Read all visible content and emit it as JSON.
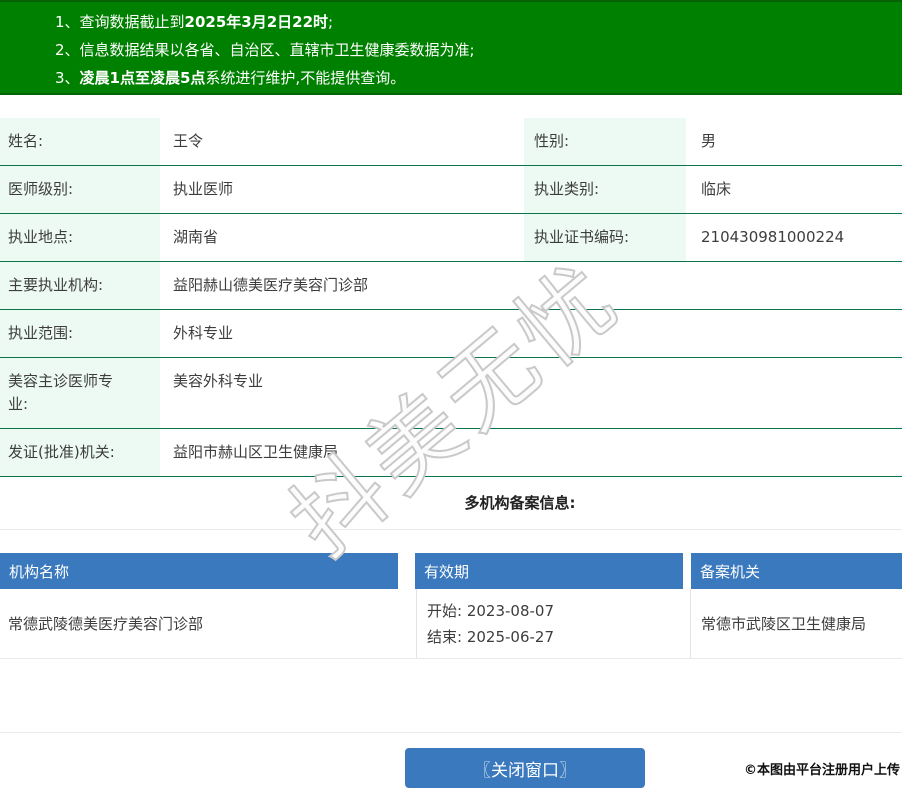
{
  "banner": {
    "notices": [
      [
        {
          "t": "1、查询数据截止到",
          "b": false
        },
        {
          "t": "2025年3月2日22时",
          "b": true
        },
        {
          "t": ";",
          "b": false
        }
      ],
      [
        {
          "t": "2、信息数据结果以各省、自治区、直辖市卫生健康委数据为准;",
          "b": false
        }
      ],
      [
        {
          "t": "3、",
          "b": false
        },
        {
          "t": "凌晨1点至凌晨5点",
          "b": true
        },
        {
          "t": "系统进行维护,不能提供查询。",
          "b": false
        }
      ]
    ]
  },
  "info_table": {
    "rows": [
      {
        "pair": true,
        "label1": "姓名:",
        "value1": "王令",
        "label2": "性别:",
        "value2": "男"
      },
      {
        "pair": true,
        "label1": "医师级别:",
        "value1": "执业医师",
        "label2": "执业类别:",
        "value2": "临床"
      },
      {
        "pair": true,
        "label1": "执业地点:",
        "value1": "湖南省",
        "label2": "执业证书编码:",
        "value2": "210430981000224"
      },
      {
        "pair": false,
        "label1": "主要执业机构:",
        "value1": "益阳赫山德美医疗美容门诊部"
      },
      {
        "pair": false,
        "label1": "执业范围:",
        "value1": "外科专业"
      },
      {
        "pair": false,
        "label1": "美容主诊医师专业:",
        "value1": "美容外科专业"
      },
      {
        "pair": false,
        "label1": "发证(批准)机关:",
        "value1": "益阳市赫山区卫生健康局"
      }
    ]
  },
  "filing_table": {
    "title": "多机构备案信息:",
    "columns": [
      "机构名称",
      "有效期",
      "备案机关"
    ],
    "rows": [
      {
        "org": "常德武陵德美医疗美容门诊部",
        "validity": [
          {
            "label": "开始:",
            "date": "2023-08-07"
          },
          {
            "label": "结束:",
            "date": "2025-06-27"
          }
        ],
        "authority": "常德市武陵区卫生健康局"
      }
    ]
  },
  "watermark": {
    "text": "抖美无忧"
  },
  "footer": {
    "close_button_label": "〖关闭窗口〗",
    "credit": "©本图由平台注册用户上传"
  },
  "colors": {
    "banner_green": "#008000",
    "row_line_green": "#0b7549",
    "label_mint": "#edfaf3",
    "table_header_blue": "#3a79bd",
    "button_blue": "#3a79bd"
  }
}
